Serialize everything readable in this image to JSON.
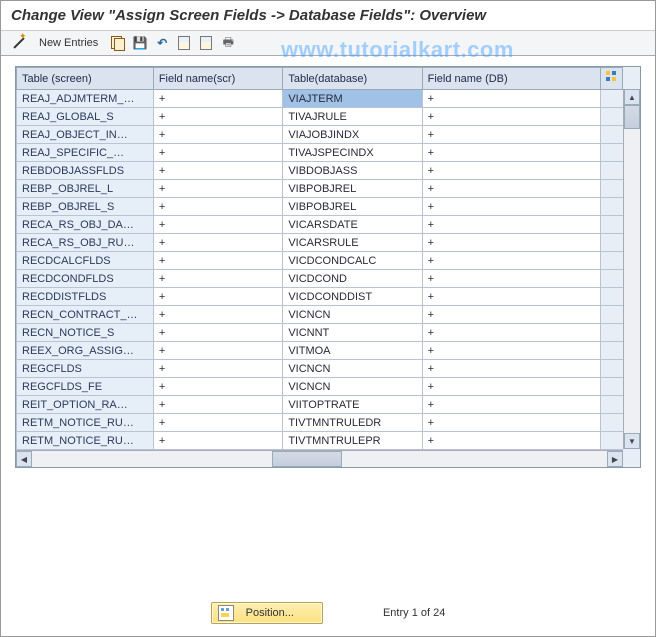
{
  "title": "Change View \"Assign Screen Fields -> Database Fields\": Overview",
  "watermark": "www.tutorialkart.com",
  "toolbar": {
    "new_entries": "New Entries"
  },
  "columns": {
    "c0": "Table (screen)",
    "c1": "Field name(scr)",
    "c2": "Table(database)",
    "c3": "Field name (DB)"
  },
  "rows": [
    {
      "a": "REAJ_ADJMTERM_…",
      "b": "+",
      "c": "VIAJTERM",
      "d": "+"
    },
    {
      "a": "REAJ_GLOBAL_S",
      "b": "+",
      "c": "TIVAJRULE",
      "d": "+"
    },
    {
      "a": "REAJ_OBJECT_IN…",
      "b": "+",
      "c": "VIAJOBJINDX",
      "d": "+"
    },
    {
      "a": "REAJ_SPECIFIC_…",
      "b": "+",
      "c": "TIVAJSPECINDX",
      "d": "+"
    },
    {
      "a": "REBDOBJASSFLDS",
      "b": "+",
      "c": "VIBDOBJASS",
      "d": "+"
    },
    {
      "a": "REBP_OBJREL_L",
      "b": "+",
      "c": "VIBPOBJREL",
      "d": "+"
    },
    {
      "a": "REBP_OBJREL_S",
      "b": "+",
      "c": "VIBPOBJREL",
      "d": "+"
    },
    {
      "a": "RECA_RS_OBJ_DA…",
      "b": "+",
      "c": "VICARSDATE",
      "d": "+"
    },
    {
      "a": "RECA_RS_OBJ_RU…",
      "b": "+",
      "c": "VICARSRULE",
      "d": "+"
    },
    {
      "a": "RECDCALCFLDS",
      "b": "+",
      "c": "VICDCONDCALC",
      "d": "+"
    },
    {
      "a": "RECDCONDFLDS",
      "b": "+",
      "c": "VICDCOND",
      "d": "+"
    },
    {
      "a": "RECDDISTFLDS",
      "b": "+",
      "c": "VICDCONDDIST",
      "d": "+"
    },
    {
      "a": "RECN_CONTRACT_…",
      "b": "+",
      "c": "VICNCN",
      "d": "+"
    },
    {
      "a": "RECN_NOTICE_S",
      "b": "+",
      "c": "VICNNT",
      "d": "+"
    },
    {
      "a": "REEX_ORG_ASSIG…",
      "b": "+",
      "c": "VITMOA",
      "d": "+"
    },
    {
      "a": "REGCFLDS",
      "b": "+",
      "c": "VICNCN",
      "d": "+"
    },
    {
      "a": "REGCFLDS_FE",
      "b": "+",
      "c": "VICNCN",
      "d": "+"
    },
    {
      "a": "REIT_OPTION_RA…",
      "b": "+",
      "c": "VIITOPTRATE",
      "d": "+"
    },
    {
      "a": "RETM_NOTICE_RU…",
      "b": "+",
      "c": "TIVTMNTRULEDR",
      "d": "+"
    },
    {
      "a": "RETM_NOTICE_RU…",
      "b": "+",
      "c": "TIVTMNTRULEPR",
      "d": "+"
    }
  ],
  "footer": {
    "position_label": "Position...",
    "entry_text": "Entry 1 of 24"
  }
}
